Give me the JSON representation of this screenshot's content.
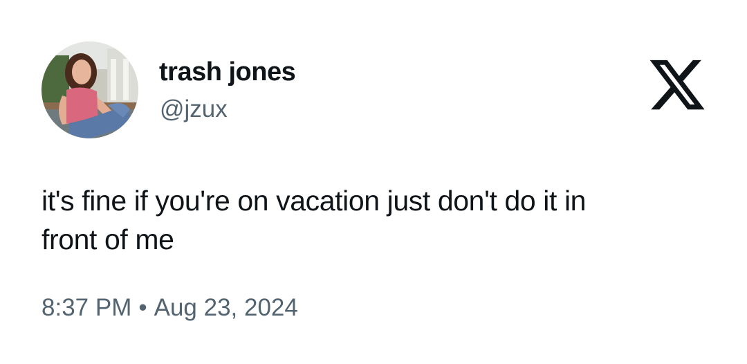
{
  "author": {
    "display_name": "trash jones",
    "handle": "@jzux",
    "avatar": "profile-photo"
  },
  "brand": {
    "icon": "x-logo-icon"
  },
  "tweet": {
    "lines": [
      "it's fine if you're on vacation just don't do it in",
      "front of me"
    ],
    "time": "8:37 PM",
    "separator": "•",
    "date": "Aug 23, 2024"
  },
  "colors": {
    "text": "#0f1419",
    "secondary": "#536471",
    "background": "#ffffff"
  }
}
